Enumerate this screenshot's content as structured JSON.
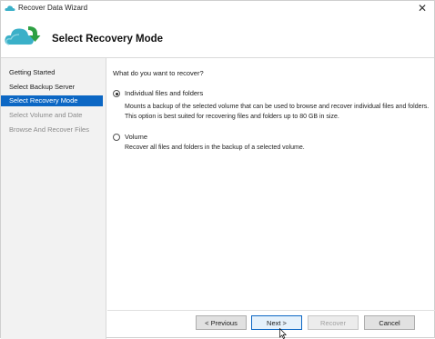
{
  "window": {
    "title": "Recover Data Wizard"
  },
  "header": {
    "heading": "Select Recovery Mode"
  },
  "sidebar": {
    "steps": [
      {
        "label": "Getting Started",
        "state": "done"
      },
      {
        "label": "Select Backup Server",
        "state": "done"
      },
      {
        "label": "Select Recovery Mode",
        "state": "active"
      },
      {
        "label": "Select Volume and Date",
        "state": "pending"
      },
      {
        "label": "Browse And Recover Files",
        "state": "pending"
      }
    ]
  },
  "main": {
    "question": "What do you want to recover?",
    "options": [
      {
        "label": "Individual files and folders",
        "checked": true,
        "description": "Mounts a backup of the selected volume that can be used to browse and recover individual files and folders. This option is best suited for recovering files and folders up to 80 GB in size."
      },
      {
        "label": "Volume",
        "checked": false,
        "description": "Recover all files and folders in the backup of a selected volume."
      }
    ]
  },
  "buttons": {
    "previous": "< Previous",
    "next": "Next >",
    "recover": "Recover",
    "cancel": "Cancel"
  },
  "colors": {
    "accent": "#0c67c4",
    "cloud": "#3ab0c8",
    "arrow": "#2ea043"
  }
}
